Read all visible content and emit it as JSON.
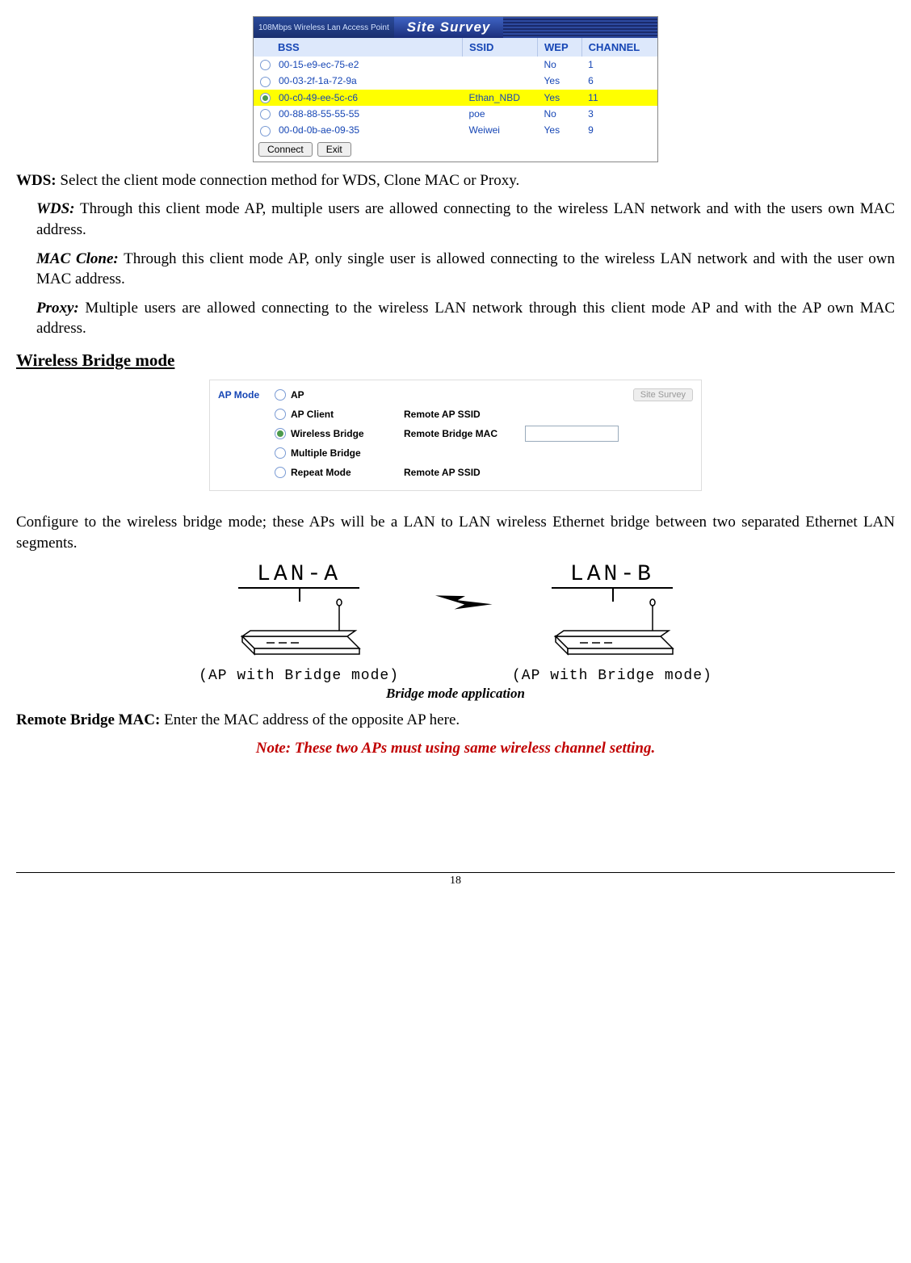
{
  "site_survey": {
    "banner_tag": "108Mbps Wireless Lan Access Point",
    "banner_title": "Site Survey",
    "headers": {
      "bss": "BSS",
      "ssid": "SSID",
      "wep": "WEP",
      "channel": "CHANNEL"
    },
    "rows": [
      {
        "bss": "00-15-e9-ec-75-e2",
        "ssid": "",
        "wep": "No",
        "channel": "1",
        "selected": false
      },
      {
        "bss": "00-03-2f-1a-72-9a",
        "ssid": "",
        "wep": "Yes",
        "channel": "6",
        "selected": false
      },
      {
        "bss": "00-c0-49-ee-5c-c6",
        "ssid": "Ethan_NBD",
        "wep": "Yes",
        "channel": "11",
        "selected": true
      },
      {
        "bss": "00-88-88-55-55-55",
        "ssid": "poe",
        "wep": "No",
        "channel": "3",
        "selected": false
      },
      {
        "bss": "00-0d-0b-ae-09-35",
        "ssid": "Weiwei",
        "wep": "Yes",
        "channel": "9",
        "selected": false
      }
    ],
    "buttons": {
      "connect": "Connect",
      "exit": "Exit"
    }
  },
  "text": {
    "wds_intro_label": "WDS:",
    "wds_intro_body": " Select the client mode connection method for WDS, Clone MAC or Proxy.",
    "wds_label": "WDS:",
    "wds_body": " Through this client mode AP, multiple users are allowed connecting to the wireless LAN network and with the users own MAC address.",
    "mac_label": "MAC Clone:",
    "mac_body": " Through this client mode AP, only single user is allowed connecting to the wireless LAN network and with the user own MAC address.",
    "proxy_label": "Proxy:",
    "proxy_body": " Multiple users are allowed connecting to the wireless LAN network through this client mode AP and with the AP own MAC address.",
    "section_bridge": "Wireless Bridge mode",
    "bridge_para": "Configure to the wireless bridge mode; these APs will be a LAN to LAN wireless Ethernet bridge between two separated Ethernet LAN segments.",
    "fig_caption": "Bridge mode application",
    "remote_label": "Remote Bridge MAC:",
    "remote_body": " Enter the MAC address of the opposite AP here.",
    "note": "Note: These two APs must using same wireless channel setting.",
    "page_num": "18"
  },
  "apmode": {
    "title": "AP Mode",
    "options": {
      "ap": "AP",
      "ap_client": "AP Client",
      "wireless_bridge": "Wireless Bridge",
      "multiple_bridge": "Multiple Bridge",
      "repeat_mode": "Repeat Mode"
    },
    "fields": {
      "remote_ap_ssid": "Remote AP SSID",
      "remote_bridge_mac": "Remote Bridge MAC"
    },
    "survey_btn": "Site Survey"
  },
  "diagram": {
    "lan_a": "LAN-A",
    "lan_b": "LAN-B",
    "caption_a": "(AP with Bridge mode)",
    "caption_b": "(AP with Bridge mode)"
  }
}
